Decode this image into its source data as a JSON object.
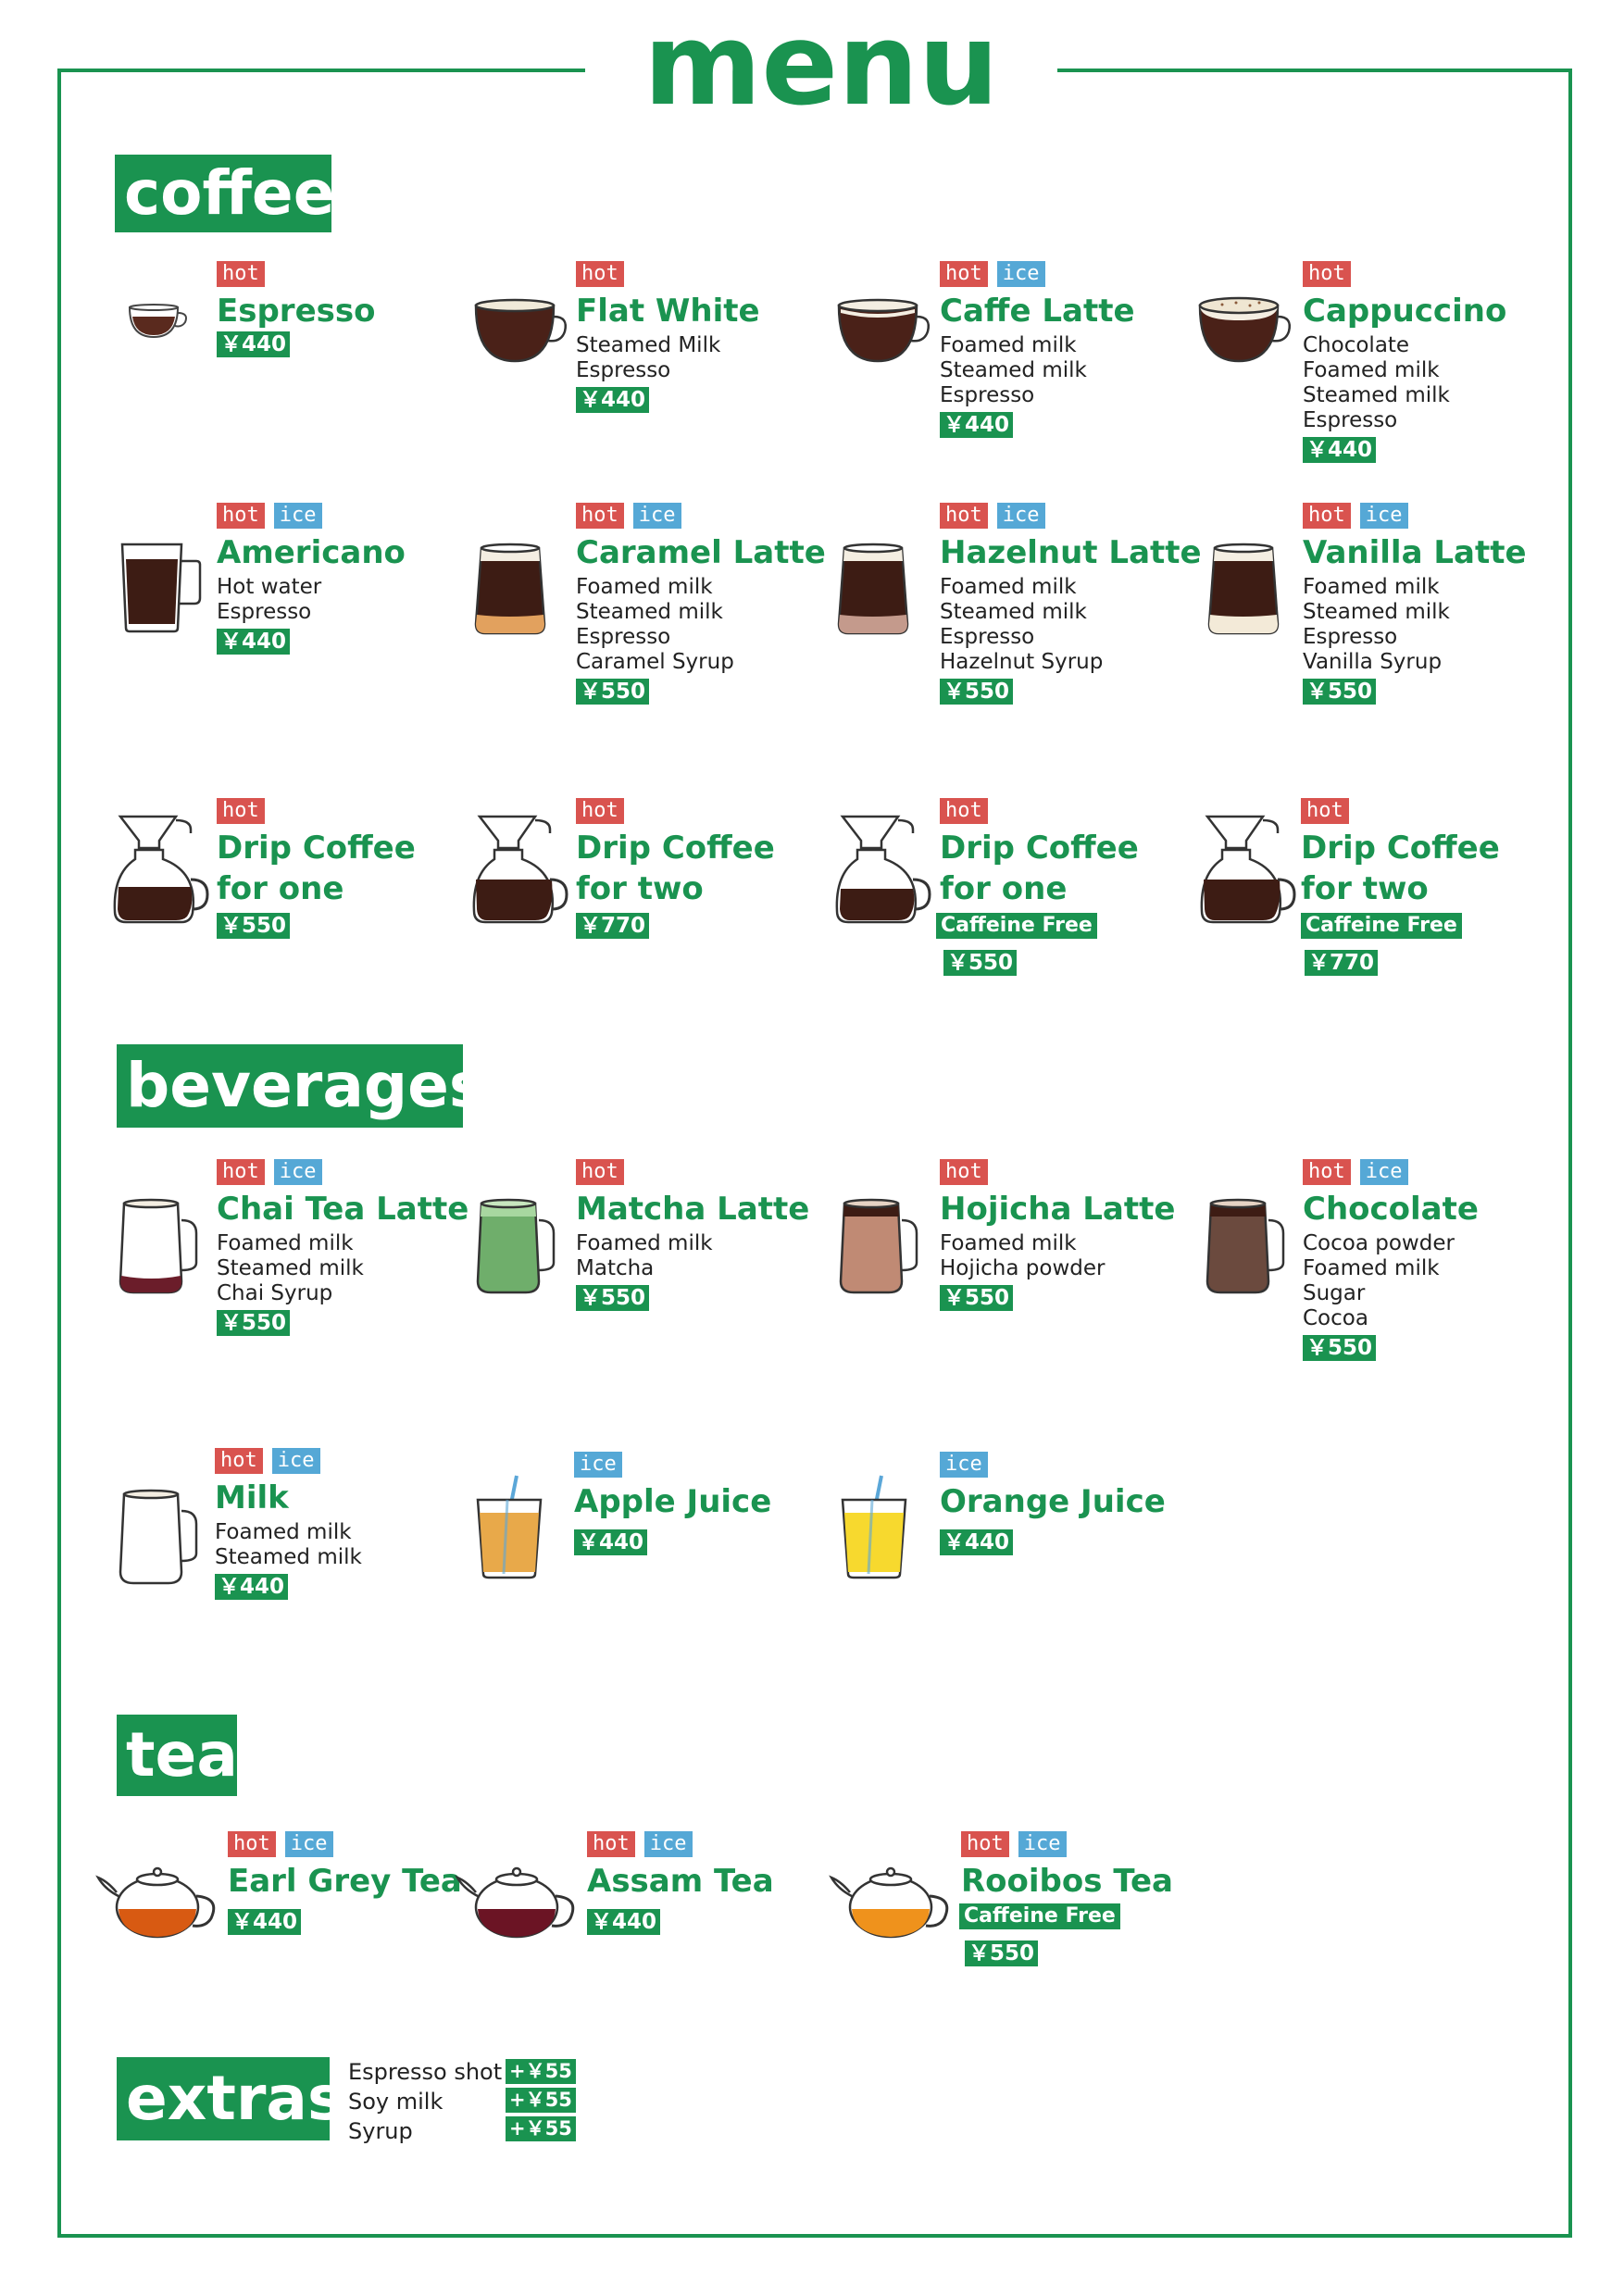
{
  "title": "menu",
  "sections": {
    "coffee": "coffee",
    "beverages": "beverages",
    "tea": "tea",
    "extras": "extras"
  },
  "tags": {
    "hot": "hot",
    "ice": "ice"
  },
  "coffee": [
    {
      "name": "Espresso",
      "ingredients": [],
      "price": "￥440",
      "hot": true,
      "ice": false
    },
    {
      "name": "Flat White",
      "ingredients": [
        "Steamed Milk",
        "Espresso"
      ],
      "price": "￥440",
      "hot": true,
      "ice": false
    },
    {
      "name": "Caffe Latte",
      "ingredients": [
        "Foamed milk",
        "Steamed milk",
        "Espresso"
      ],
      "price": "￥440",
      "hot": true,
      "ice": true
    },
    {
      "name": "Cappuccino",
      "ingredients": [
        "Chocolate",
        "Foamed milk",
        "Steamed milk",
        "Espresso"
      ],
      "price": "￥440",
      "hot": true,
      "ice": false
    },
    {
      "name": "Americano",
      "ingredients": [
        "Hot water",
        "Espresso"
      ],
      "price": "￥440",
      "hot": true,
      "ice": true
    },
    {
      "name": "Caramel Latte",
      "ingredients": [
        "Foamed milk",
        "Steamed milk",
        "Espresso",
        "Caramel Syrup"
      ],
      "price": "￥550",
      "hot": true,
      "ice": true
    },
    {
      "name": "Hazelnut Latte",
      "ingredients": [
        "Foamed milk",
        "Steamed milk",
        "Espresso",
        "Hazelnut Syrup"
      ],
      "price": "￥550",
      "hot": true,
      "ice": true
    },
    {
      "name": "Vanilla Latte",
      "ingredients": [
        "Foamed milk",
        "Steamed milk",
        "Espresso",
        "Vanilla Syrup"
      ],
      "price": "￥550",
      "hot": true,
      "ice": true
    },
    {
      "name": "Drip Coffee",
      "name2": "for one",
      "price": "￥550",
      "hot": true
    },
    {
      "name": "Drip Coffee",
      "name2": "for two",
      "price": "￥770",
      "hot": true
    },
    {
      "name": "Drip Coffee",
      "name2": "for one",
      "badge": "Caffeine Free",
      "price": "￥550",
      "hot": true
    },
    {
      "name": "Drip Coffee",
      "name2": "for two",
      "badge": "Caffeine Free",
      "price": "￥770",
      "hot": true
    }
  ],
  "beverages": [
    {
      "name": "Chai Tea Latte",
      "ingredients": [
        "Foamed milk",
        "Steamed milk",
        "Chai Syrup"
      ],
      "price": "￥550"
    },
    {
      "name": "Matcha Latte",
      "ingredients": [
        "Foamed milk",
        "Matcha"
      ],
      "price": "￥550"
    },
    {
      "name": "Hojicha Latte",
      "ingredients": [
        "Foamed milk",
        "Hojicha powder"
      ],
      "price": "￥550"
    },
    {
      "name": "Chocolate",
      "ingredients": [
        "Cocoa powder",
        "Foamed milk",
        "Sugar",
        "Cocoa"
      ],
      "price": "￥550"
    },
    {
      "name": "Milk",
      "ingredients": [
        "Foamed milk",
        "Steamed milk"
      ],
      "price": "￥440"
    },
    {
      "name": "Apple Juice",
      "ingredients": [],
      "price": "￥440"
    },
    {
      "name": "Orange Juice",
      "ingredients": [],
      "price": "￥440"
    }
  ],
  "tea": [
    {
      "name": "Earl Grey Tea",
      "price": "￥440"
    },
    {
      "name": "Assam Tea",
      "price": "￥440"
    },
    {
      "name": "Rooibos Tea",
      "badge": "Caffeine Free",
      "price": "￥550"
    }
  ],
  "extras": [
    {
      "name": "Espresso shot",
      "price": "+￥55"
    },
    {
      "name": "Soy milk",
      "price": "+￥55"
    },
    {
      "name": "Syrup",
      "price": "+￥55"
    }
  ],
  "colors": {
    "brand_green": "#1a9350",
    "hot": "#d9534f",
    "ice": "#55a8d6"
  }
}
